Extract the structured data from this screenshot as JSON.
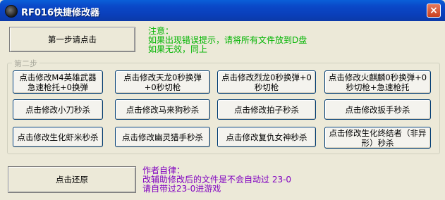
{
  "window": {
    "title": "RF016快捷修改器",
    "close_label": "×"
  },
  "step1": {
    "button_label": "第一步请点击"
  },
  "notice": {
    "heading": "注意：",
    "line1": "如果出现错误提示，请将所有文件放到D盘",
    "line2": "如果无效，同上"
  },
  "step2": {
    "legend": "第二步",
    "buttons": [
      "点击修改M4英雄武器急速枪托+0换弹",
      "点击修改天龙0秒换弹+0秒切枪",
      "点击修改烈龙0秒换弹+0秒切枪",
      "点击修改火麒麟0秒换弹+0秒切枪+急速枪托",
      "点击修改小刀秒杀",
      "点击修改马来狗秒杀",
      "点击修改拍子秒杀",
      "点击修改扳手秒杀",
      "点击修改生化虾米秒杀",
      "点击修改幽灵猎手秒杀",
      "点击修改复仇女神秒杀",
      "点击修改生化终结者（非异形）秒杀"
    ]
  },
  "restore": {
    "button_label": "点击还原"
  },
  "author": {
    "heading": "作者自律：",
    "line1": "改辅助修改后的文件是不会自动过 23-0",
    "line2": "请自带过23-0进游戏"
  }
}
